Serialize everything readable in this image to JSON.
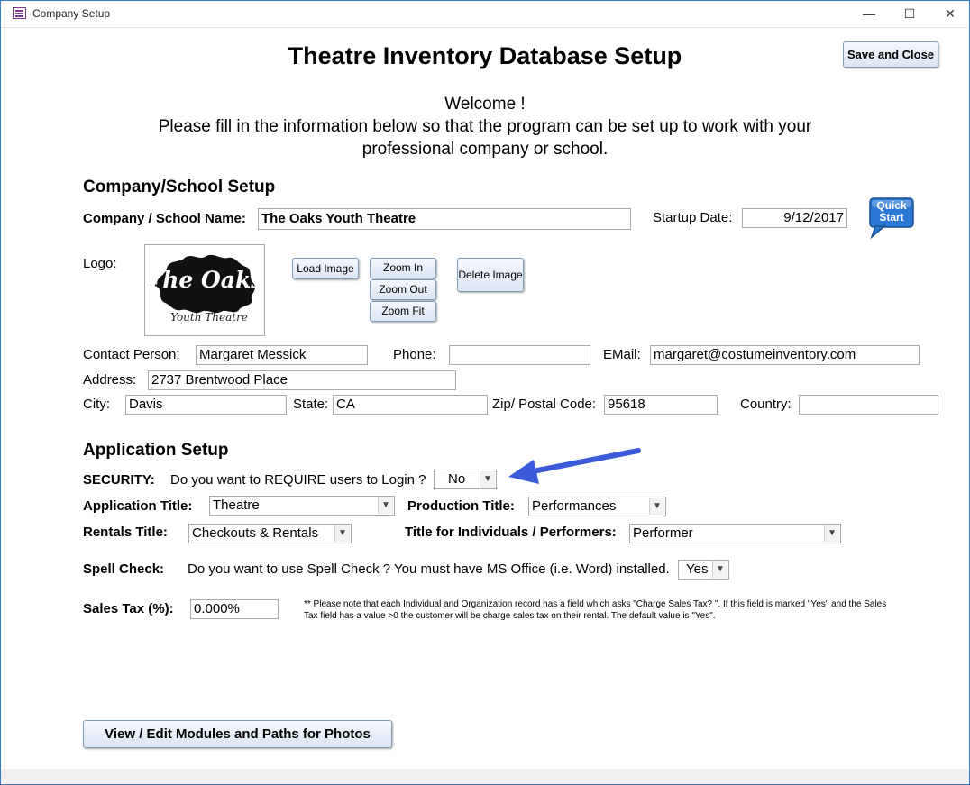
{
  "window": {
    "title": "Company Setup",
    "minimize": "—",
    "maximize": "☐",
    "close": "✕"
  },
  "header": {
    "title": "Theatre Inventory Database Setup",
    "save_close": "Save and Close",
    "welcome_lines": [
      "Welcome !",
      "Please fill in the information below so that the program can be set up to work with your",
      "professional company or school."
    ]
  },
  "company": {
    "section_title": "Company/School Setup",
    "name_label": "Company / School Name:",
    "name_value": "The Oaks Youth Theatre",
    "startup_label": "Startup Date:",
    "startup_value": "9/12/2017",
    "quick_start": [
      "Quick",
      "Start"
    ],
    "logo_label": "Logo:",
    "logo_text_main": "The Oaks",
    "logo_text_sub": "Youth Theatre",
    "load_image": "Load Image",
    "zoom_in": "Zoom In",
    "zoom_out": "Zoom Out",
    "zoom_fit": "Zoom Fit",
    "delete_image": "Delete Image",
    "contact_label": "Contact Person:",
    "contact_value": "Margaret Messick",
    "phone_label": "Phone:",
    "phone_value": "",
    "email_label": "EMail:",
    "email_value": "margaret@costumeinventory.com",
    "address_label": "Address:",
    "address_value": "2737 Brentwood Place",
    "city_label": "City:",
    "city_value": "Davis",
    "state_label": "State:",
    "state_value": "CA",
    "zip_label": "Zip/ Postal Code:",
    "zip_value": "95618",
    "country_label": "Country:",
    "country_value": ""
  },
  "application": {
    "section_title": "Application Setup",
    "security_label": "SECURITY:",
    "security_question": "Do you want to REQUIRE users to Login ?",
    "security_value": "No",
    "app_title_label": "Application Title:",
    "app_title_value": "Theatre",
    "production_title_label": "Production Title:",
    "production_title_value": "Performances",
    "rentals_title_label": "Rentals Title:",
    "rentals_title_value": "Checkouts & Rentals",
    "individuals_title_label": "Title for Individuals / Performers:",
    "individuals_title_value": "Performer",
    "spell_label": "Spell Check:",
    "spell_question": "Do you want to use Spell Check ?  You must have MS Office (i.e. Word) installed.",
    "spell_value": "Yes",
    "sales_tax_label": "Sales Tax (%):",
    "sales_tax_value": "0.000%",
    "sales_tax_note": "** Please note that each Individual and Organization record has a field which asks \"Charge Sales Tax? \".  If this field is marked \"Yes\" and the Sales Tax field has a value >0 the customer will be charge sales tax on their rental.  The default value is \"Yes\"."
  },
  "footer": {
    "modules_button": "View / Edit Modules and Paths for Photos"
  },
  "colors": {
    "arrow": "#3b5bdb",
    "window_border": "#3a78c9",
    "button_border": "#7f9db9",
    "quick_start": "#2b78d4"
  },
  "icons": {
    "annotation_arrow": "arrow-icon",
    "dropdown": "chevron-down-icon"
  }
}
